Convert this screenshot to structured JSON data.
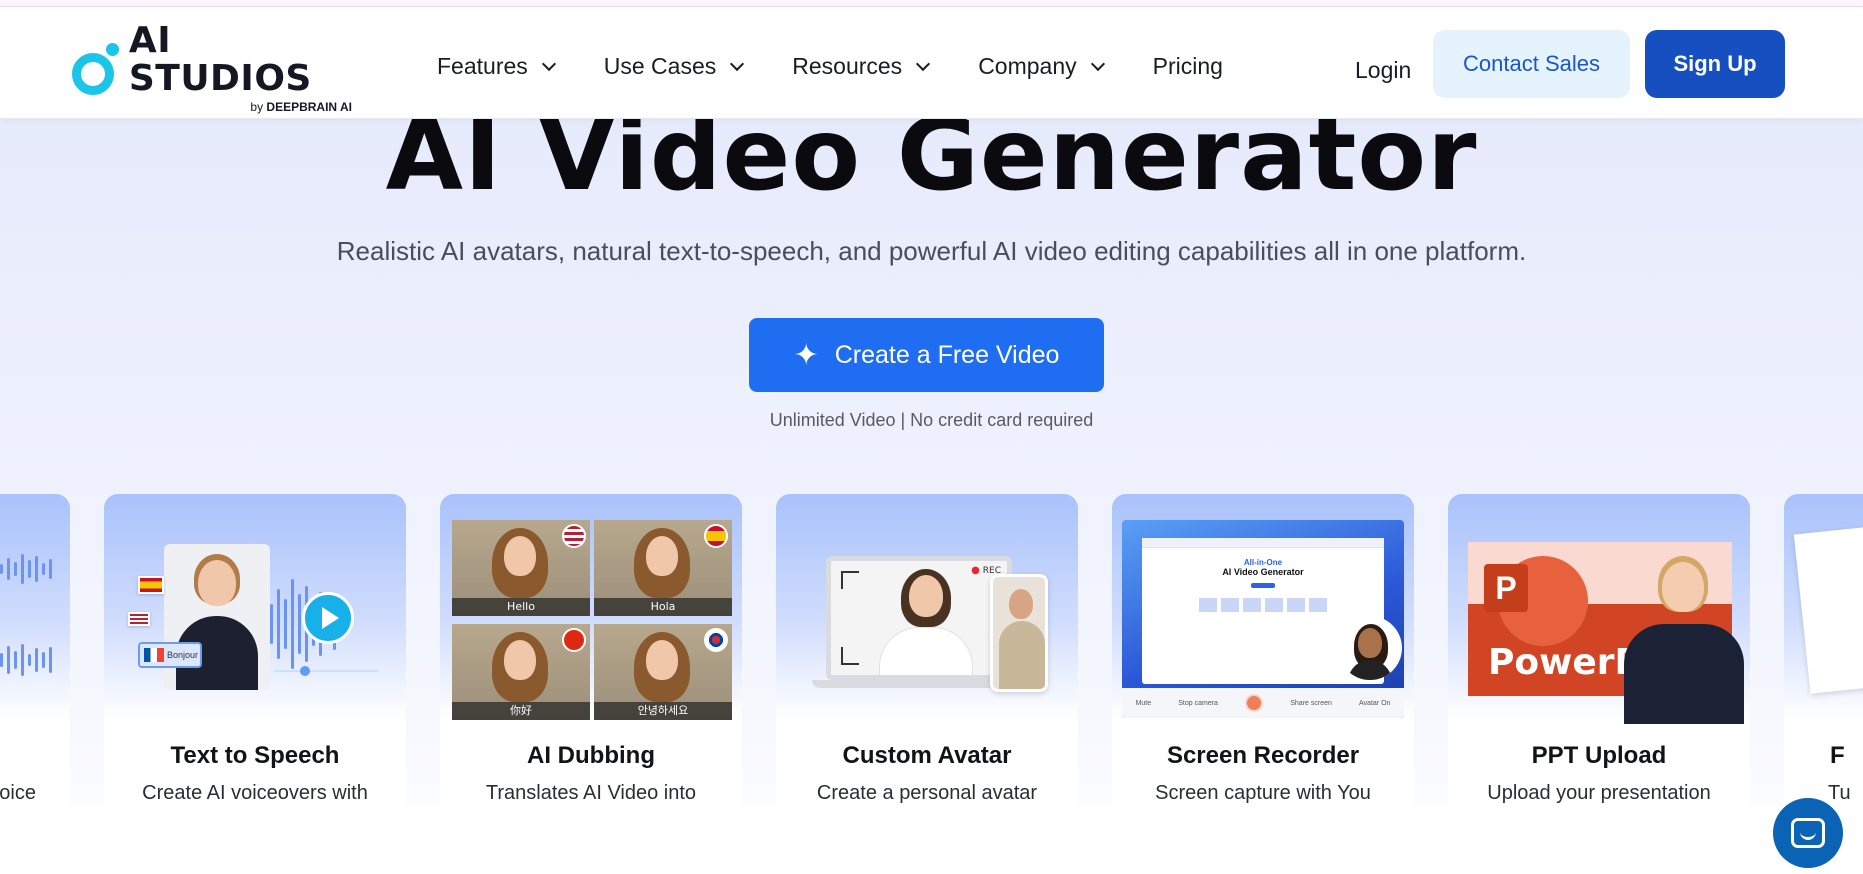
{
  "header": {
    "logo": {
      "title": "AI STUDIOS",
      "by": "by",
      "brand": "DEEPBRAIN AI"
    },
    "nav": [
      {
        "label": "Features",
        "dropdown": true
      },
      {
        "label": "Use Cases",
        "dropdown": true
      },
      {
        "label": "Resources",
        "dropdown": true
      },
      {
        "label": "Company",
        "dropdown": true
      },
      {
        "label": "Pricing",
        "dropdown": false
      }
    ],
    "login": "Login",
    "contact_sales": "Contact Sales",
    "sign_up": "Sign Up"
  },
  "hero": {
    "title": "AI Video Generator",
    "subtitle": "Realistic AI avatars, natural text-to-speech, and powerful AI video editing capabilities all in one platform.",
    "cta": "Create a Free Video",
    "note": "Unlimited Video | No credit card required"
  },
  "cards": [
    {
      "title": "",
      "desc": "oice"
    },
    {
      "title": "Text to Speech",
      "desc": "Create AI voiceovers with",
      "bonjour": "Bonjour"
    },
    {
      "title": "AI Dubbing",
      "desc": "Translates AI Video into",
      "captions": [
        "Hello",
        "Hola",
        "你好",
        "안녕하세요"
      ]
    },
    {
      "title": "Custom Avatar",
      "desc": "Create a personal avatar",
      "rec": "REC"
    },
    {
      "title": "Screen Recorder",
      "desc": "Screen capture with You",
      "screen": {
        "headline_top": "All-in-One",
        "headline": "AI Video Generator",
        "controls": [
          "Mute",
          "Stop camera",
          "Share screen",
          "Avatar On"
        ]
      }
    },
    {
      "title": "PPT Upload",
      "desc": "Upload your presentation",
      "slide_text": "PowerP"
    },
    {
      "title": "F",
      "desc": "Tu"
    }
  ],
  "colors": {
    "primary": "#1f6ef2",
    "signup": "#1650c0",
    "contact_bg": "#e5f3fe",
    "logo_accent": "#1ac5e8"
  }
}
